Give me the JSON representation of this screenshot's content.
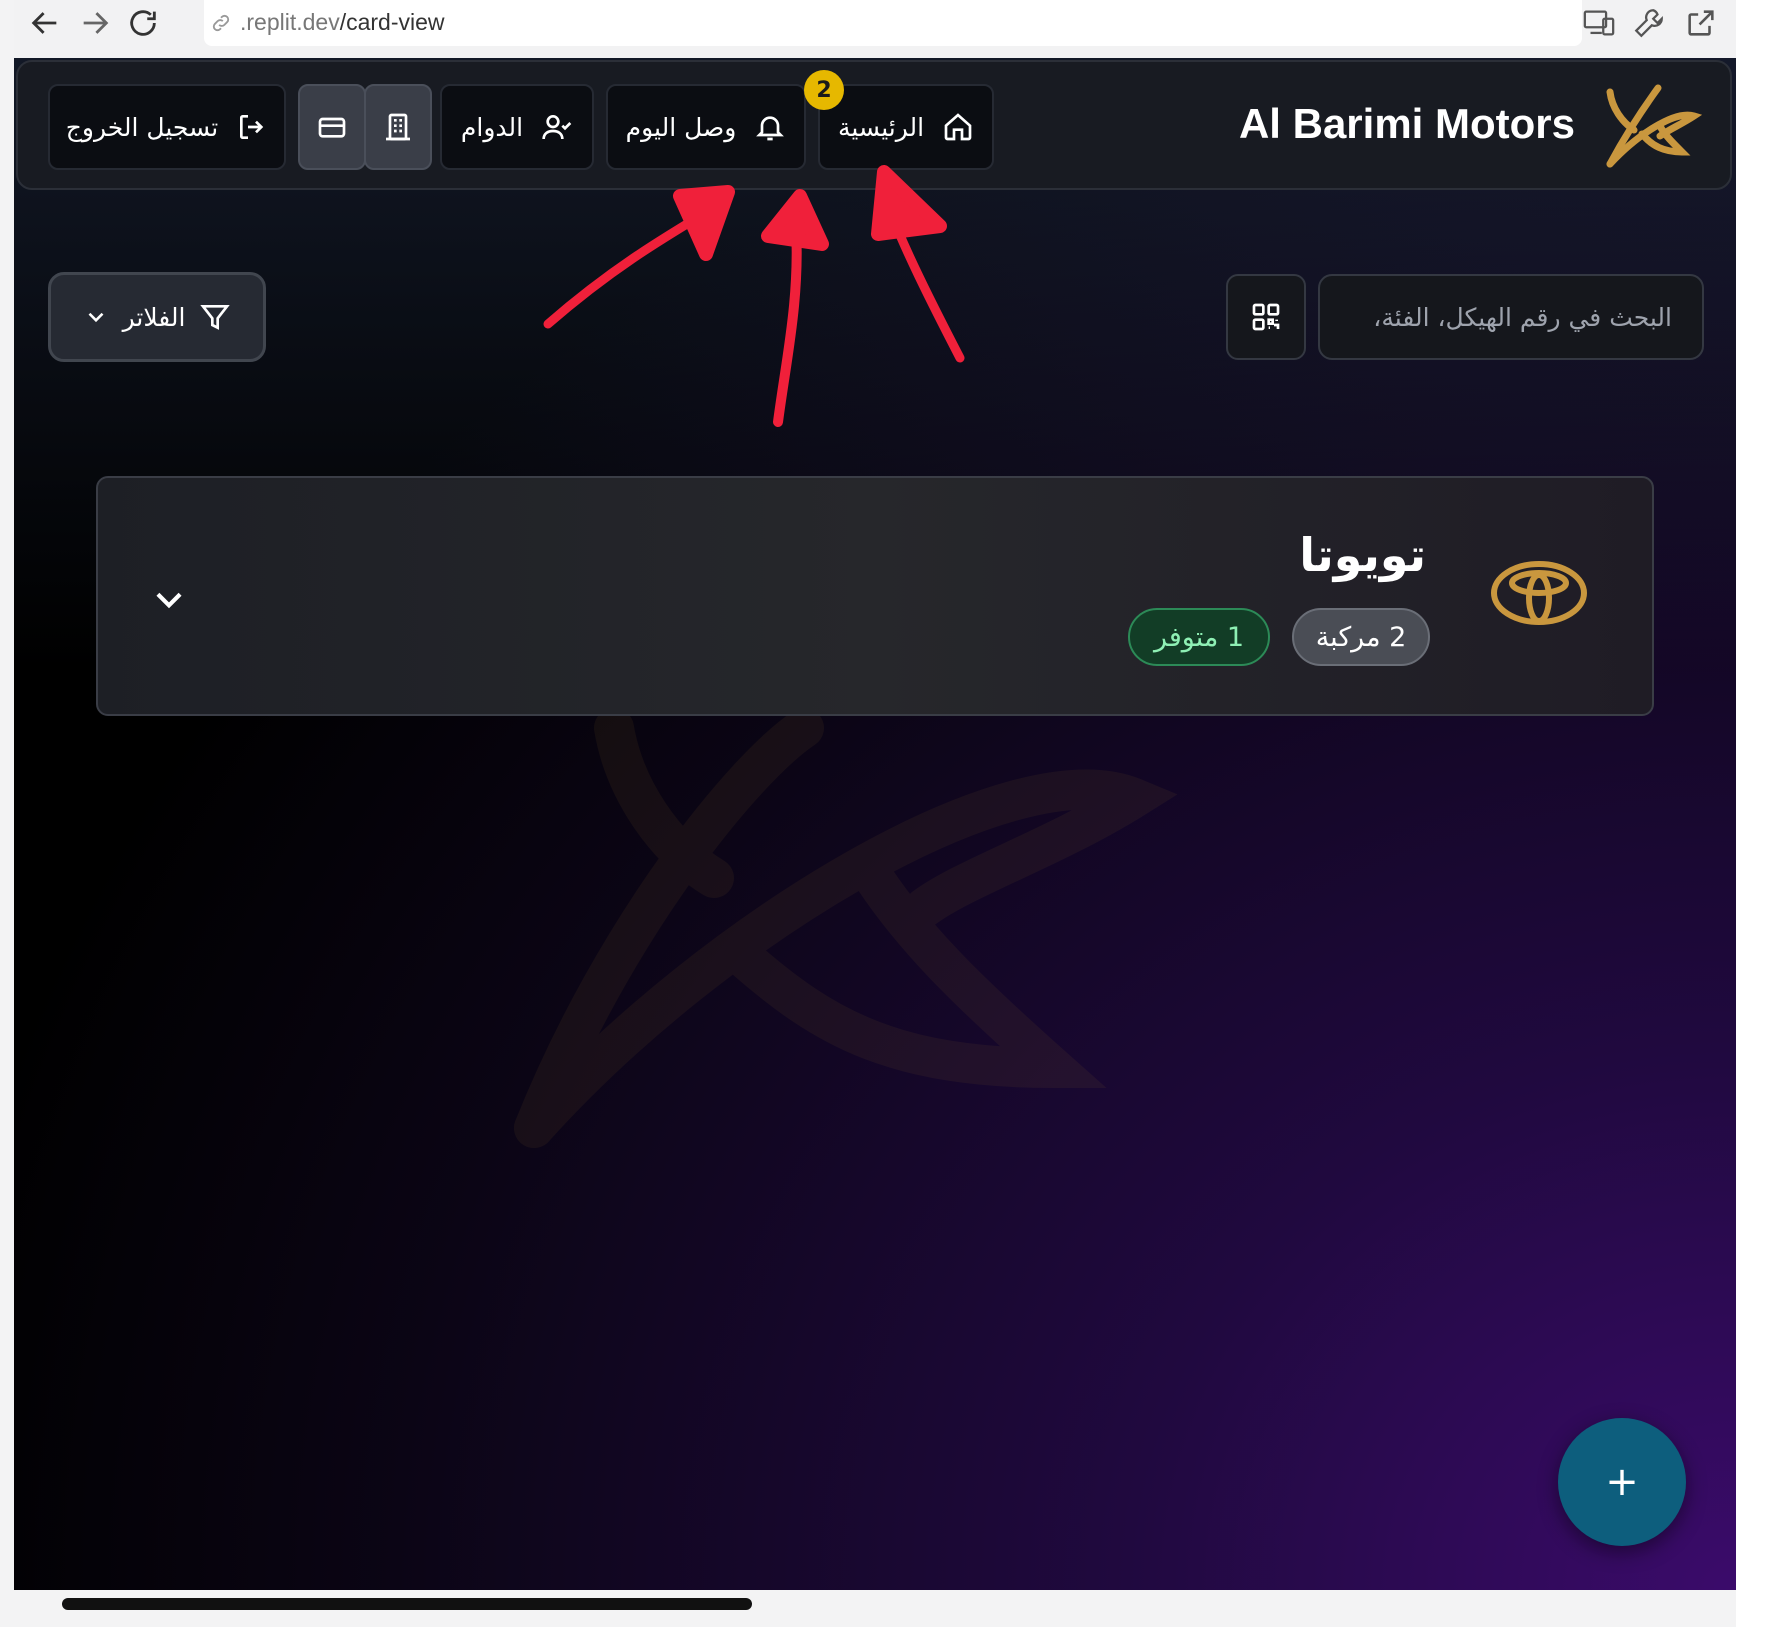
{
  "browser": {
    "url_dim": ".replit.dev",
    "url_path": "/card-view"
  },
  "header": {
    "brand": "Al Barimi Motors",
    "nav": {
      "home": "الرئيسية",
      "arrived_today": "وصل اليوم",
      "arrived_today_badge": "2",
      "attendance": "الدوام",
      "logout": "تسجيل الخروج"
    }
  },
  "toolbar": {
    "search_placeholder": "البحث في رقم الهيكل، الفئة،",
    "filters_label": "الفلاتر"
  },
  "brands": [
    {
      "name": "تويوتا",
      "vehicles_count": "2 مركبة",
      "available": "1 متوفر"
    }
  ],
  "fab": {
    "label": "+"
  },
  "colors": {
    "accent_gold": "#C9973E",
    "badge_yellow": "#E6B800",
    "fab_teal": "#0D5E7D",
    "annotation_red": "#F0203A"
  }
}
